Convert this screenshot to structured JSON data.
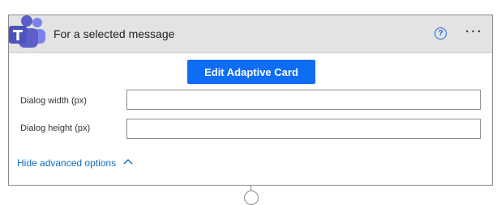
{
  "card": {
    "title": "For a selected message",
    "logo_icon": "microsoft-teams-icon",
    "help_icon": "help-circle-icon",
    "more_icon": "more-options-icon",
    "help_glyph": "?",
    "more_glyph": "···"
  },
  "actions": {
    "edit_label": "Edit Adaptive Card"
  },
  "fields": [
    {
      "label": "Dialog width (px)",
      "value": ""
    },
    {
      "label": "Dialog height (px)",
      "value": ""
    }
  ],
  "advanced": {
    "label": "Hide advanced options",
    "icon": "chevron-up-icon"
  },
  "colors": {
    "accent": "#0f6cf5",
    "teams_purple": "#5b5fc7",
    "link": "#0f6cbd"
  }
}
